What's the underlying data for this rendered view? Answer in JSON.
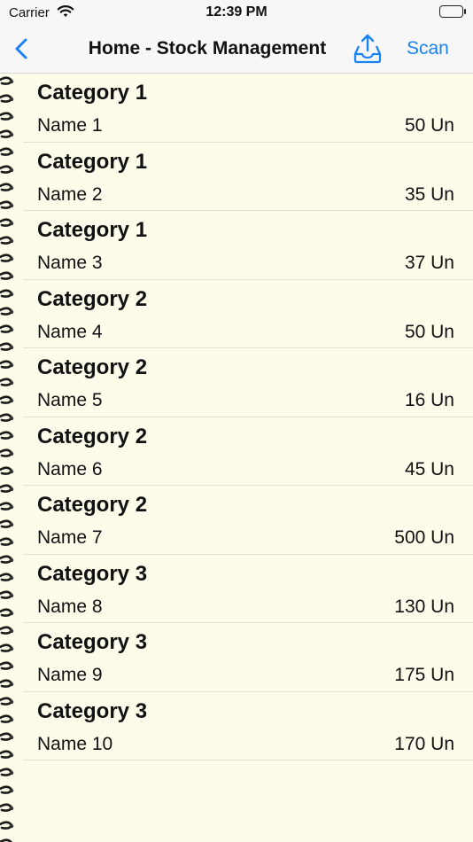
{
  "status_bar": {
    "carrier": "Carrier",
    "time": "12:39 PM"
  },
  "nav": {
    "title": "Home - Stock Management",
    "scan_label": "Scan",
    "accent_color": "#1a82f7",
    "back_icon": "chevron-left-icon",
    "share_icon": "tray-upload-icon"
  },
  "background_color": "#fdfbea",
  "items": [
    {
      "category": "Category 1",
      "name": "Name 1",
      "quantity": "50 Un"
    },
    {
      "category": "Category 1",
      "name": "Name 2",
      "quantity": "35 Un"
    },
    {
      "category": "Category 1",
      "name": "Name 3",
      "quantity": "37 Un"
    },
    {
      "category": "Category 2",
      "name": "Name 4",
      "quantity": "50 Un"
    },
    {
      "category": "Category 2",
      "name": "Name 5",
      "quantity": "16 Un"
    },
    {
      "category": "Category 2",
      "name": "Name 6",
      "quantity": "45 Un"
    },
    {
      "category": "Category 2",
      "name": "Name 7",
      "quantity": "500 Un"
    },
    {
      "category": "Category 3",
      "name": "Name 8",
      "quantity": "130 Un"
    },
    {
      "category": "Category 3",
      "name": "Name 9",
      "quantity": "175 Un"
    },
    {
      "category": "Category 3",
      "name": "Name 10",
      "quantity": "170 Un"
    }
  ]
}
